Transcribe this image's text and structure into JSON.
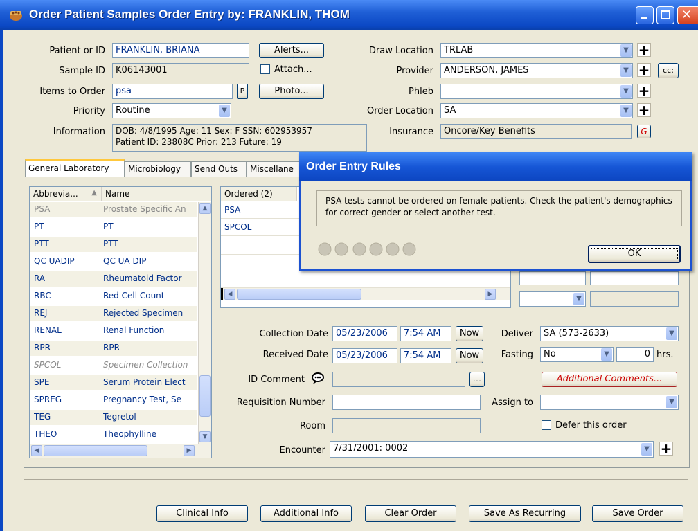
{
  "window": {
    "title": "Order Patient Samples   Order Entry by: FRANKLIN, THOM"
  },
  "form": {
    "patient_label": "Patient or ID",
    "patient_value": "FRANKLIN, BRIANA",
    "alerts_button": "Alerts...",
    "sample_label": "Sample ID",
    "sample_value": "K06143001",
    "attach_label": "Attach...",
    "items_label": "Items to Order",
    "items_value": "psa",
    "p_button": "P",
    "photo_button": "Photo...",
    "priority_label": "Priority",
    "priority_value": "Routine",
    "information_label": "Information",
    "information_line1": "DOB: 4/8/1995  Age: 11  Sex: F  SSN: 602953957",
    "information_line2": "Patient ID: 23808C  Prior: 213  Future: 19",
    "draw_location_label": "Draw Location",
    "draw_location_value": "TRLAB",
    "provider_label": "Provider",
    "provider_value": "ANDERSON, JAMES",
    "cc_button": "cc:",
    "phleb_label": "Phleb",
    "phleb_value": "",
    "order_location_label": "Order Location",
    "order_location_value": "SA",
    "insurance_label": "Insurance",
    "insurance_value": "Oncore/Key Benefits",
    "g_button": "G"
  },
  "tabs": [
    {
      "label": "General Laboratory"
    },
    {
      "label": "Microbiology"
    },
    {
      "label": "Send Outs"
    },
    {
      "label": "Miscellane"
    }
  ],
  "test_list": {
    "col_abbrev": "Abbrevia...",
    "col_name": "Name",
    "rows": [
      {
        "abbrev": "PSA",
        "name": "Prostate Specific An"
      },
      {
        "abbrev": "PT",
        "name": "PT"
      },
      {
        "abbrev": "PTT",
        "name": "PTT"
      },
      {
        "abbrev": "QC UADIP",
        "name": "QC UA DIP"
      },
      {
        "abbrev": "RA",
        "name": "Rheumatoid Factor"
      },
      {
        "abbrev": "RBC",
        "name": "Red Cell Count"
      },
      {
        "abbrev": "REJ",
        "name": "Rejected Specimen"
      },
      {
        "abbrev": "RENAL",
        "name": "Renal Function"
      },
      {
        "abbrev": "RPR",
        "name": "RPR"
      },
      {
        "abbrev": "SPCOL",
        "name": "Specimen Collection"
      },
      {
        "abbrev": "SPE",
        "name": "Serum Protein Elect"
      },
      {
        "abbrev": "SPREG",
        "name": "Pregnancy Test, Se"
      },
      {
        "abbrev": "TEG",
        "name": "Tegretol"
      },
      {
        "abbrev": "THEO",
        "name": "Theophylline"
      }
    ]
  },
  "ordered": {
    "header": "Ordered (2)",
    "rows": [
      "PSA",
      "SPCOL"
    ]
  },
  "details": {
    "collection_label": "Collection Date",
    "collection_date": "05/23/2006",
    "collection_time": "7:54 AM",
    "received_label": "Received Date",
    "received_date": "05/23/2006",
    "received_time": "7:54 AM",
    "now_button": "Now",
    "deliver_label": "Deliver",
    "deliver_value": "SA (573-2633)",
    "fasting_label": "Fasting",
    "fasting_value": "No",
    "fasting_hours": "0",
    "hours_unit": "hrs.",
    "id_comment_label": "ID Comment",
    "ellipsis_button": "...",
    "additional_comments_button": "Additional Comments...",
    "requisition_label": "Requisition Number",
    "assign_label": "Assign to",
    "room_label": "Room",
    "defer_label": "Defer this order",
    "encounter_label": "Encounter",
    "encounter_value": "7/31/2001:  0002"
  },
  "buttons": {
    "clinical_info": "Clinical Info",
    "additional_info": "Additional Info",
    "clear_order": "Clear Order",
    "save_recurring": "Save As Recurring",
    "save_order": "Save Order"
  },
  "dialog": {
    "title": "Order Entry Rules",
    "message": "PSA tests cannot be ordered on female patients. Check the patient's demographics for correct gender or select another test.",
    "ok_button": "OK"
  },
  "colors": {
    "title_blue": "#0b48c4",
    "field_text": "#002e8a",
    "accent_red": "#cc0000"
  }
}
